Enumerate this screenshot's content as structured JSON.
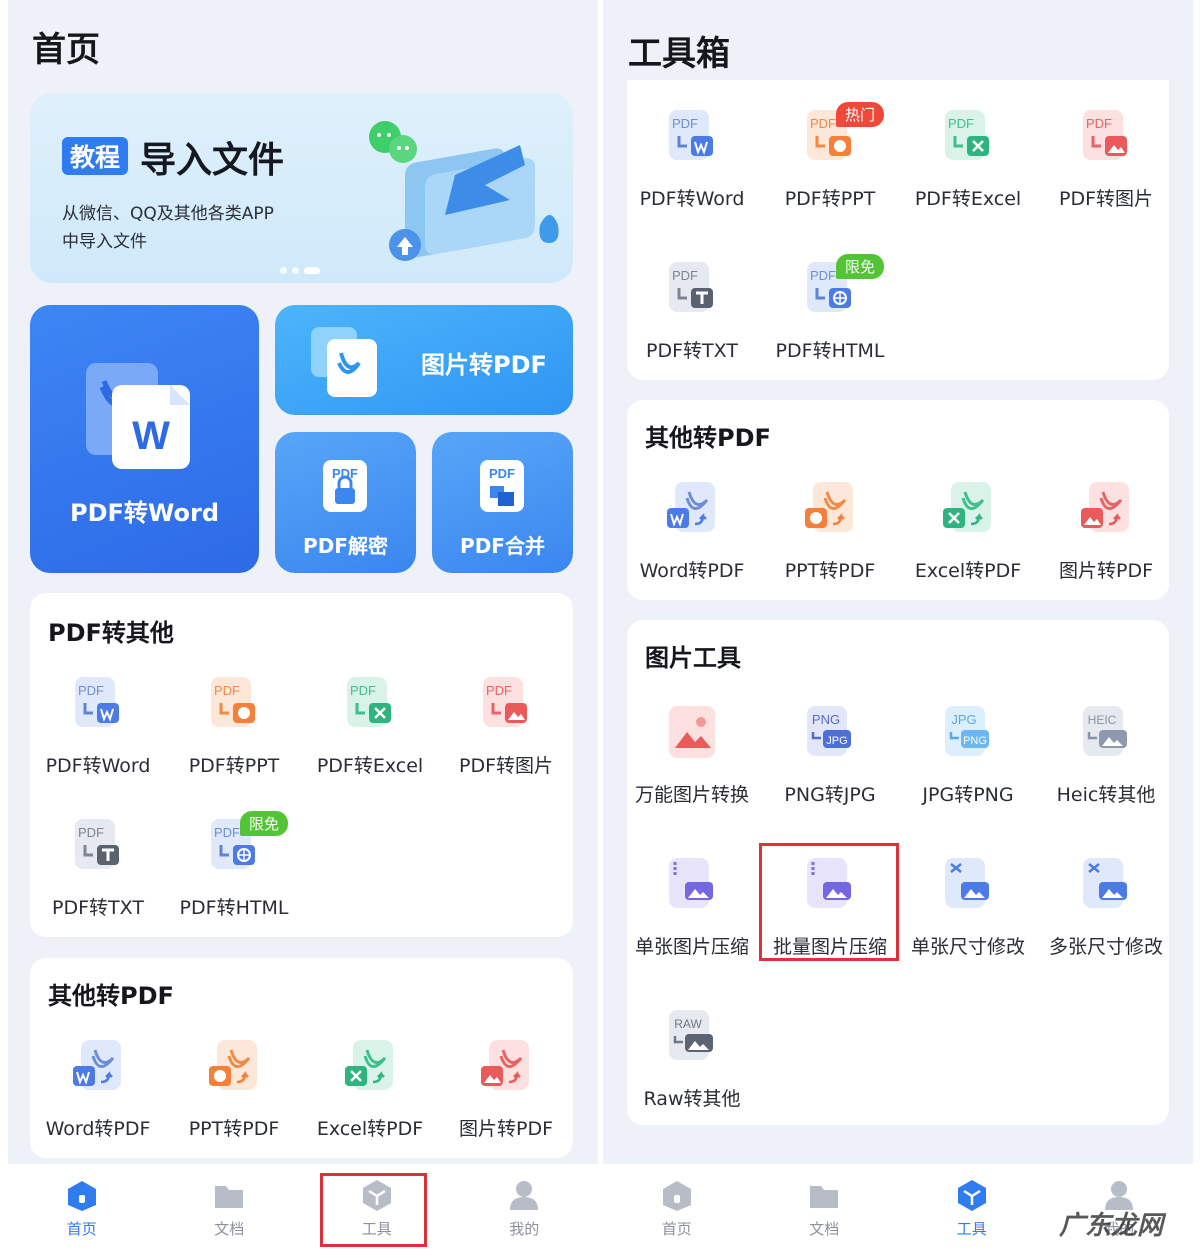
{
  "left": {
    "title": "首页",
    "banner": {
      "tag": "教程",
      "title": "导入文件",
      "line1": "从微信、QQ及其他各类APP",
      "line2": "中导入文件"
    },
    "tiles": {
      "pdf_to_word": "PDF转Word",
      "image_to_pdf": "图片转PDF",
      "pdf_decrypt": "PDF解密",
      "pdf_merge": "PDF合并"
    },
    "section1": {
      "title": "PDF转其他",
      "items": [
        "PDF转Word",
        "PDF转PPT",
        "PDF转Excel",
        "PDF转图片",
        "PDF转TXT",
        "PDF转HTML"
      ],
      "badge_free": "限免"
    },
    "section2": {
      "title": "其他转PDF",
      "items": [
        "Word转PDF",
        "PPT转PDF",
        "Excel转PDF",
        "图片转PDF"
      ]
    },
    "tabs": [
      "首页",
      "文档",
      "工具",
      "我的"
    ]
  },
  "right": {
    "title": "工具箱",
    "section1": {
      "items": [
        "PDF转Word",
        "PDF转PPT",
        "PDF转Excel",
        "PDF转图片",
        "PDF转TXT",
        "PDF转HTML"
      ],
      "badge_hot": "热门",
      "badge_free": "限免"
    },
    "section2": {
      "title": "其他转PDF",
      "items": [
        "Word转PDF",
        "PPT转PDF",
        "Excel转PDF",
        "图片转PDF"
      ]
    },
    "section3": {
      "title": "图片工具",
      "items": [
        "万能图片转换",
        "PNG转JPG",
        "JPG转PNG",
        "Heic转其他",
        "单张图片压缩",
        "批量图片压缩",
        "单张尺寸修改",
        "多张尺寸修改",
        "Raw转其他"
      ]
    },
    "tabs": [
      "首页",
      "文档",
      "工具",
      "我的"
    ]
  },
  "icon_text": {
    "pdf": "PDF",
    "png": "PNG",
    "jpg": "JPG",
    "heic": "HEIC",
    "raw": "RAW",
    "w": "W"
  },
  "watermark": "广东龙网",
  "colors": {
    "accent": "#2f7cf1",
    "highlight": "#e0313a",
    "free_badge": "#53c435",
    "hot_badge": "#f0493a"
  }
}
